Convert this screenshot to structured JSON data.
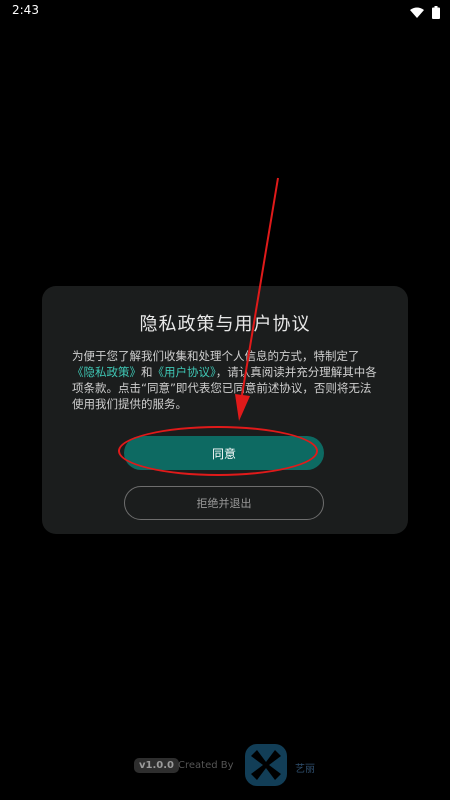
{
  "status_bar": {
    "time": "2:43",
    "icons": [
      "wifi-icon",
      "battery-icon"
    ]
  },
  "dialog": {
    "title": "隐私政策与用户协议",
    "body": {
      "part1": "为便于您了解我们收集和处理个人信息的方式，特制定了",
      "privacy_link": "《隐私政策》",
      "and": "和",
      "agreement_link": "《用户协议》",
      "part2": "，请认真阅读并充分理解其中各项条款。点击“同意”即代表您已同意前述协议，否则将无法使用我们提供的服务。"
    },
    "agree_label": "同意",
    "reject_label": "拒绝并退出"
  },
  "footer": {
    "version": "v1.0.0",
    "created_by": "Created By",
    "brand": "艺丽"
  },
  "colors": {
    "background": "#000000",
    "dialog_bg": "#1b1d1d",
    "accent": "#0d6a62",
    "link": "#3fc7b5",
    "annotation": "#e01a1a"
  }
}
